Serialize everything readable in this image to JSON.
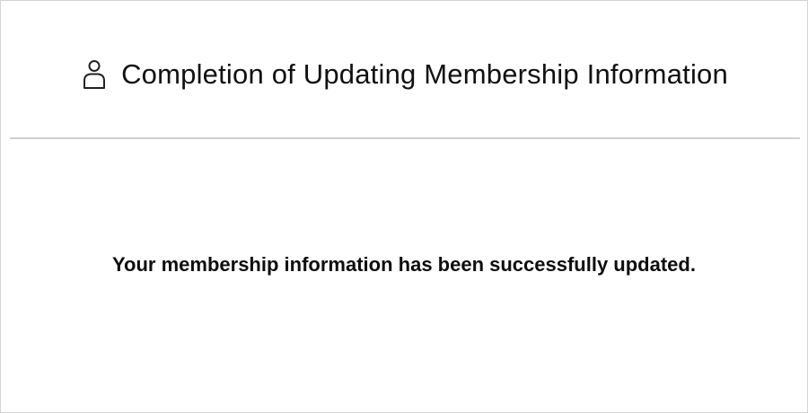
{
  "header": {
    "icon": "user-icon",
    "title": "Completion of Updating Membership Information"
  },
  "main": {
    "message": "Your membership information has been successfully updated."
  },
  "colors": {
    "text": "#111111",
    "divider": "#cfcfcf",
    "frame_border": "#d4d4d4",
    "background": "#ffffff"
  }
}
